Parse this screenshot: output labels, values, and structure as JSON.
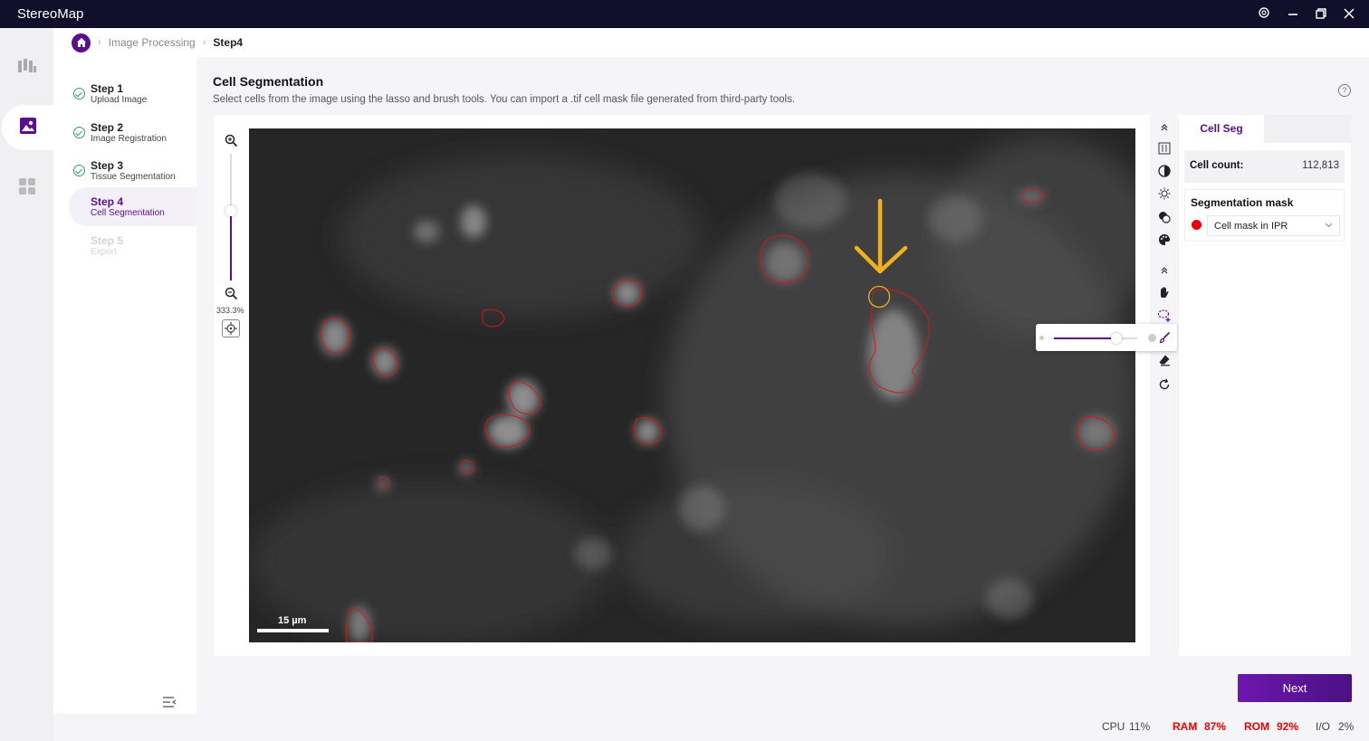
{
  "app": {
    "title": "StereoMap"
  },
  "breadcrumb": {
    "parent": "Image Processing",
    "current": "Step4"
  },
  "steps": [
    {
      "title": "Step 1",
      "subtitle": "Upload Image",
      "state": "done"
    },
    {
      "title": "Step 2",
      "subtitle": "Image Registration",
      "state": "done"
    },
    {
      "title": "Step 3",
      "subtitle": "Tissue Segmentation",
      "state": "done"
    },
    {
      "title": "Step 4",
      "subtitle": "Cell Segmentation",
      "state": "active"
    },
    {
      "title": "Step 5",
      "subtitle": "Export",
      "state": "disabled"
    }
  ],
  "main": {
    "title": "Cell Segmentation",
    "description": "Select cells from the image using the lasso and brush tools. You can import a .tif cell mask file generated from third-party tools.",
    "zoom": "333.3%",
    "scalebar": "15 µm"
  },
  "panel": {
    "tab": "Cell Seg",
    "cell_count_label": "Cell count:",
    "cell_count_value": "112,813",
    "mask_label": "Segmentation mask",
    "mask_value": "Cell mask in IPR",
    "mask_color": "#e00000"
  },
  "actions": {
    "next": "Next"
  },
  "status": {
    "cpu_label": "CPU",
    "cpu_value": "11%",
    "ram_label": "RAM",
    "ram_value": "87%",
    "rom_label": "ROM",
    "rom_value": "92%",
    "io_label": "I/O",
    "io_value": "2%"
  },
  "colors": {
    "accent": "#5a0f8e",
    "titlebar": "#120f2b",
    "annotation": "#f2b01e"
  },
  "brush_size_fraction": 0.76
}
